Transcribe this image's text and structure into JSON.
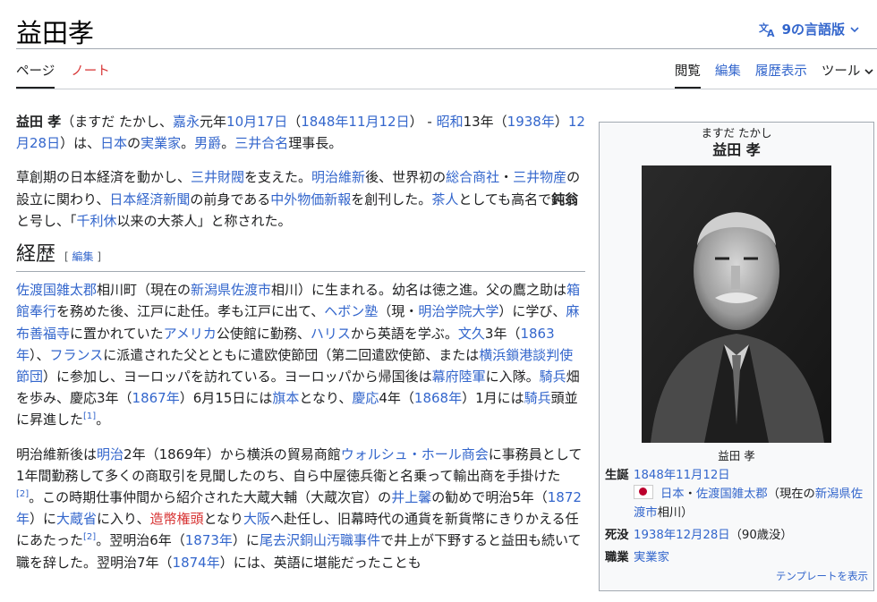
{
  "page": {
    "title": "益田孝",
    "lang_label": "9の言語版"
  },
  "tabs": {
    "page": "ページ",
    "note": "ノート",
    "read": "閲覧",
    "edit": "編集",
    "history": "履歴表示",
    "tools": "ツール"
  },
  "section": {
    "heading": "経歴",
    "edit_label": "編集"
  },
  "infobox": {
    "name_kana": "ますだ たかし",
    "name": "益田 孝",
    "caption": "益田 孝",
    "born_label": "生誕",
    "born_date": "1848年11月12日",
    "born_country": "日本",
    "born_place": "佐渡国雑太郡",
    "born_now_pre": "（現在の",
    "born_now": "新潟県佐渡市",
    "born_now_post": "相川）",
    "died_label": "死没",
    "died_date": "1938年12月28日",
    "died_age": "（90歳没）",
    "job_label": "職業",
    "job": "実業家",
    "template_link": "テンプレートを表示"
  }
}
